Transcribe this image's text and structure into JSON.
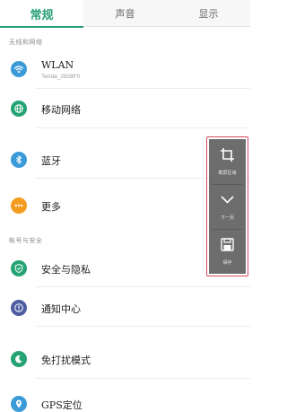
{
  "tabs": [
    {
      "label": "常规",
      "active": true
    },
    {
      "label": "声音",
      "active": false
    },
    {
      "label": "显示",
      "active": false
    }
  ],
  "sections": {
    "network_label": "无线和网络",
    "account_label": "帐号与安全"
  },
  "items": {
    "wlan": {
      "label": "WLAN",
      "sublabel": "Tenda_2828F0",
      "icon": "wifi-icon",
      "color": "#3b9bd8"
    },
    "mobile": {
      "label": "移动网络",
      "icon": "globe-icon",
      "color": "#26a374"
    },
    "bluetooth": {
      "label": "蓝牙",
      "icon": "bluetooth-icon",
      "color": "#3b9bd8"
    },
    "more": {
      "label": "更多",
      "icon": "more-dots-icon",
      "color": "#f39c1f"
    },
    "security": {
      "label": "安全与隐私",
      "icon": "shield-icon",
      "color": "#26a374"
    },
    "notify": {
      "label": "通知中心",
      "icon": "alert-icon",
      "color": "#4c5ea0"
    },
    "dnd": {
      "label": "免打扰模式",
      "icon": "moon-icon",
      "color": "#26a374"
    },
    "gps": {
      "label": "GPS定位",
      "icon": "location-pin-icon",
      "color": "#3b9bd8"
    }
  },
  "side_panel": {
    "crop_label": "截屏区域",
    "next_label": "下一页",
    "save_label": "保存"
  },
  "colors": {
    "accent": "#2aa079",
    "panel_bg": "#6d6d6d",
    "panel_outline": "#d24a5f"
  }
}
